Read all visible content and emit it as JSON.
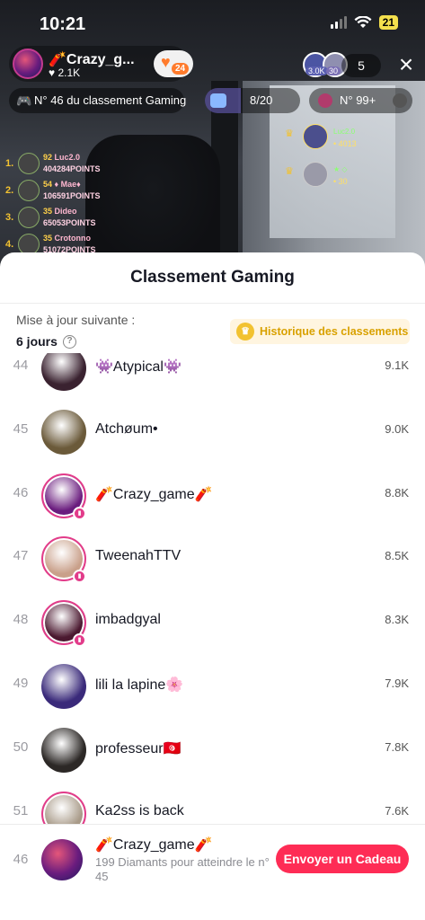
{
  "status_bar": {
    "time": "10:21",
    "battery": "21"
  },
  "host": {
    "name": "🧨Crazy_g...",
    "likes": "♥ 2.1K",
    "follow_count": "24"
  },
  "viewers": {
    "badge1": "3.0K",
    "badge2": "30",
    "count": "5"
  },
  "pills": {
    "rank": "N° 46 du classement Gaming",
    "goal": "8/20",
    "league": "N° 99+"
  },
  "overlay_left": [
    {
      "rank": "1.",
      "num": "92",
      "name": "Luc2.0",
      "points": "404284POINTS"
    },
    {
      "rank": "2.",
      "num": "54",
      "name": "♦ Mae♦",
      "points": "106591POINTS"
    },
    {
      "rank": "3.",
      "num": "35",
      "name": "Dideo",
      "points": "65053POINTS"
    },
    {
      "rank": "4.",
      "num": "35",
      "name": "Crotonno",
      "points": "51072POINTS"
    }
  ],
  "overlay_right": [
    {
      "rank": "♛",
      "name": "Luc2.0",
      "points": "• 4013"
    },
    {
      "rank": "♛",
      "name": "★ ◇",
      "points": "• 30"
    }
  ],
  "sheet": {
    "title": "Classement Gaming",
    "update_label": "Mise à jour suivante :",
    "update_value": "6 jours",
    "info": "?",
    "history": "Historique des classements"
  },
  "ranking": [
    {
      "rank": "44",
      "name": "👾Atypical👾",
      "points": "9.1K",
      "color": "#3a2230",
      "live": false
    },
    {
      "rank": "45",
      "name": "Atchøum•",
      "points": "9.0K",
      "color": "#6b5a3a",
      "live": false
    },
    {
      "rank": "46",
      "name": "🧨Crazy_game🧨",
      "points": "8.8K",
      "color": "#6a1c7e",
      "live": true
    },
    {
      "rank": "47",
      "name": "TweenahTTV",
      "points": "8.5K",
      "color": "#c9a08a",
      "live": true
    },
    {
      "rank": "48",
      "name": "imbadgyal",
      "points": "8.3K",
      "color": "#4b1930",
      "live": true
    },
    {
      "rank": "49",
      "name": "lili la lapine🌸",
      "points": "7.9K",
      "color": "#3a2a7a",
      "live": false
    },
    {
      "rank": "50",
      "name": "professeur🇹🇳",
      "points": "7.8K",
      "color": "#2c2826",
      "live": false
    },
    {
      "rank": "51",
      "name": "Ka2ss is back",
      "points": "7.6K",
      "color": "#a89a88",
      "live": true
    }
  ],
  "footer": {
    "rank": "46",
    "name": "🧨Crazy_game🧨",
    "sub": "199 Diamants pour atteindre le n° 45",
    "button": "Envoyer un Cadeau"
  }
}
